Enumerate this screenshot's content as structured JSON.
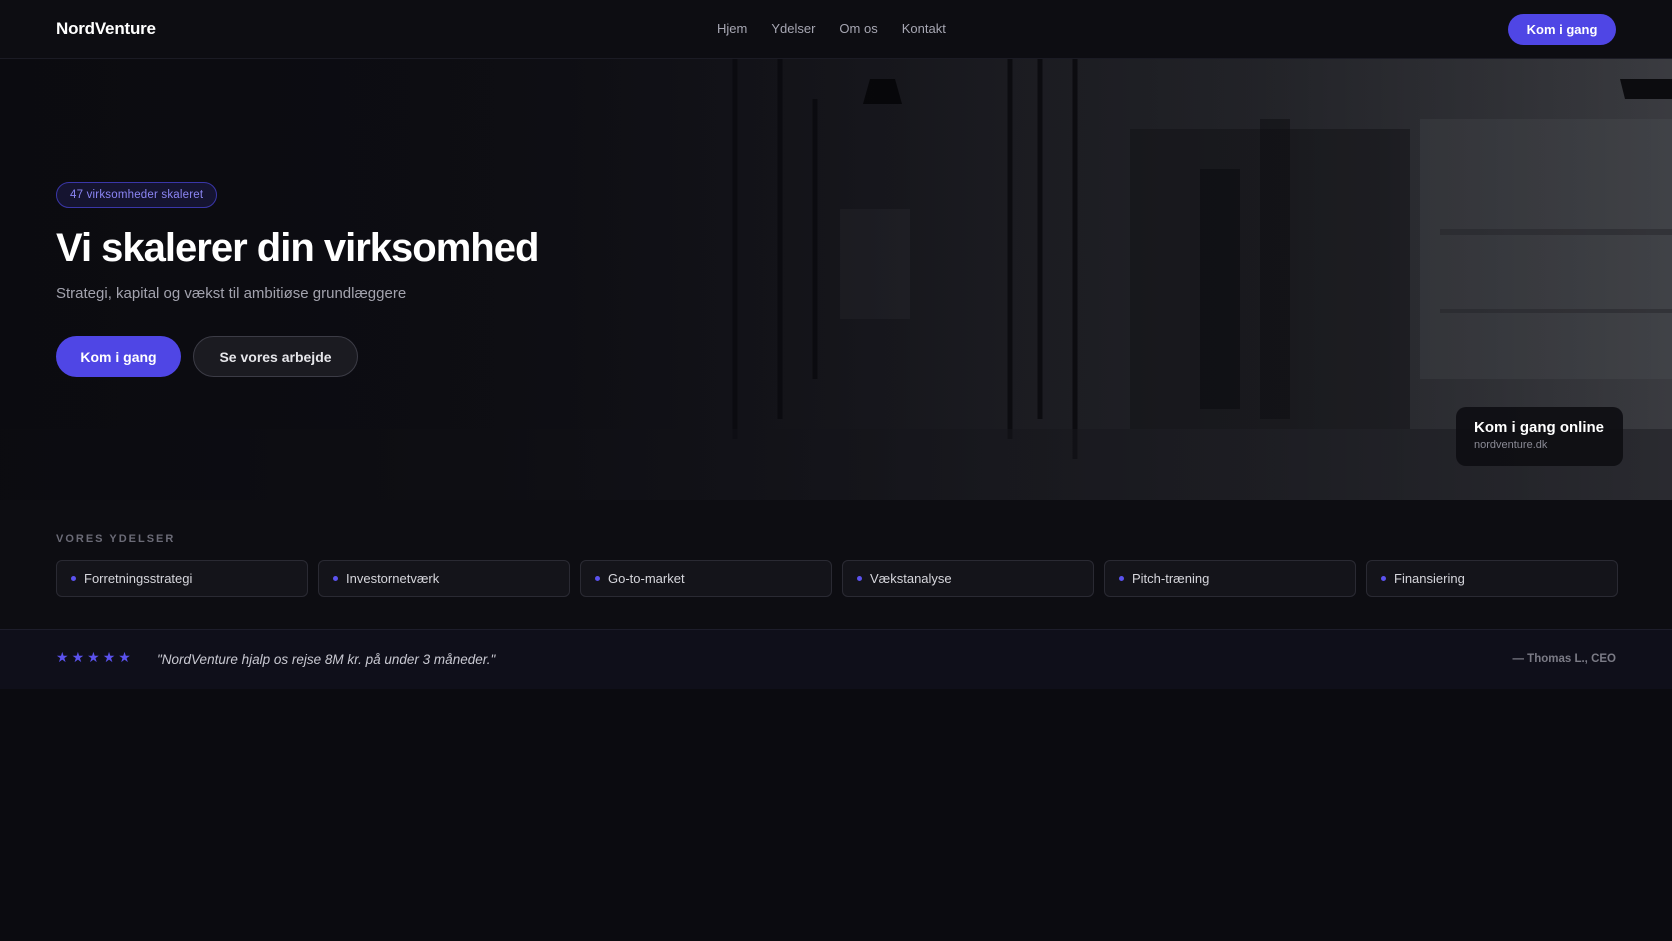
{
  "nav": {
    "logo": "NordVenture",
    "links": [
      "Hjem",
      "Ydelser",
      "Om os",
      "Kontakt"
    ],
    "cta": "Kom i gang"
  },
  "hero": {
    "badge": "47 virksomheder skaleret",
    "title": "Vi skalerer din virksomhed",
    "subtitle": "Strategi, kapital og vækst til ambitiøse grundlæggere",
    "primary_button": "Kom i gang",
    "secondary_button": "Se vores arbejde",
    "card": {
      "title": "Kom i gang online",
      "subtitle": "nordventure.dk"
    }
  },
  "services": {
    "label": "VORES YDELSER",
    "items": [
      "Forretningsstrategi",
      "Investornetværk",
      "Go-to-market",
      "Vækstanalyse",
      "Pitch-træning",
      "Finansiering"
    ]
  },
  "testimonial": {
    "stars": [
      "★",
      "★",
      "★",
      "★",
      "★"
    ],
    "rating": 5,
    "quote": "\"NordVenture hjalp os rejse 8M kr. på under 3 måneder.\"",
    "author": "— Thomas L., CEO"
  },
  "colors": {
    "accent": "#4f46e5",
    "background": "#0b0b10"
  }
}
